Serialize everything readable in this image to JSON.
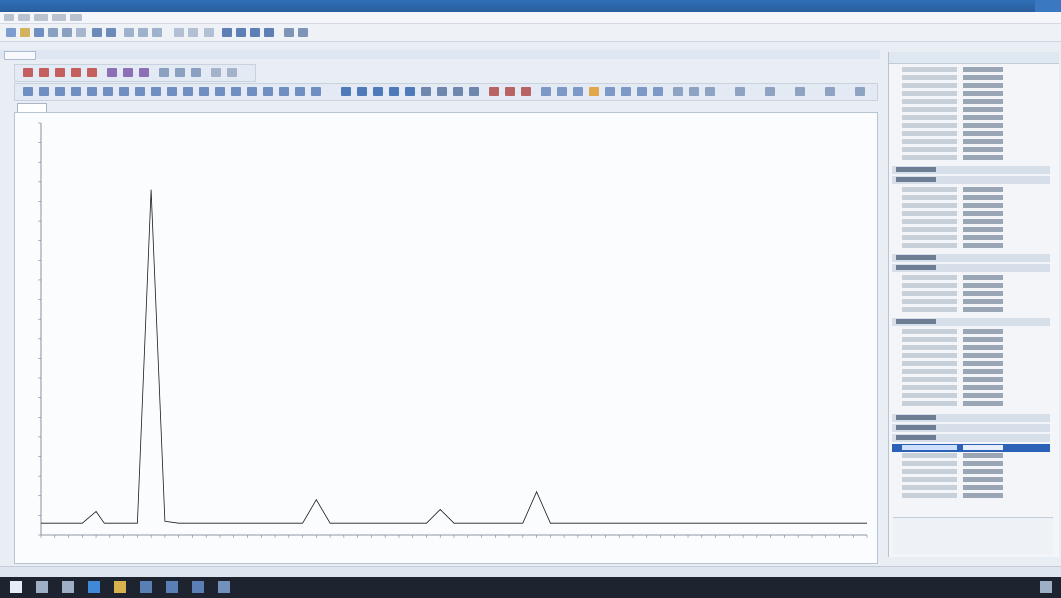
{
  "window": {
    "title": ""
  },
  "menu": {
    "items": [
      "",
      "",
      "",
      "",
      ""
    ]
  },
  "document_tab": {
    "label": ""
  },
  "chart": {
    "tab_label": "",
    "xlabel": "",
    "ylabel": ""
  },
  "chart_data": {
    "type": "line",
    "x": [
      0,
      5,
      10,
      15,
      20,
      23,
      25,
      30,
      35,
      40,
      45,
      50,
      55,
      60,
      65,
      70,
      75,
      80,
      85,
      90,
      95,
      100,
      105,
      110,
      115,
      120,
      125,
      130,
      135,
      140,
      145,
      150,
      155,
      160,
      165,
      170,
      175,
      180,
      185,
      190,
      195,
      200,
      210,
      220,
      230,
      240,
      250,
      255,
      260,
      265,
      270,
      280,
      290,
      300
    ],
    "y": [
      300,
      300,
      300,
      300,
      600,
      300,
      300,
      300,
      300,
      8800,
      350,
      300,
      300,
      300,
      300,
      300,
      300,
      300,
      300,
      300,
      300,
      900,
      300,
      300,
      300,
      300,
      300,
      300,
      300,
      300,
      650,
      300,
      300,
      300,
      300,
      300,
      300,
      1100,
      300,
      300,
      300,
      300,
      300,
      300,
      300,
      300,
      300,
      300,
      300,
      300,
      300,
      300,
      300,
      300
    ],
    "ylim": [
      0,
      10500
    ],
    "grid": false,
    "title": "",
    "xlabel": "",
    "ylabel": ""
  },
  "properties_panel": {
    "title": ""
  },
  "description": {
    "title": "",
    "text": ""
  },
  "status": {
    "text": ""
  },
  "taskbar": {
    "clock": ""
  }
}
